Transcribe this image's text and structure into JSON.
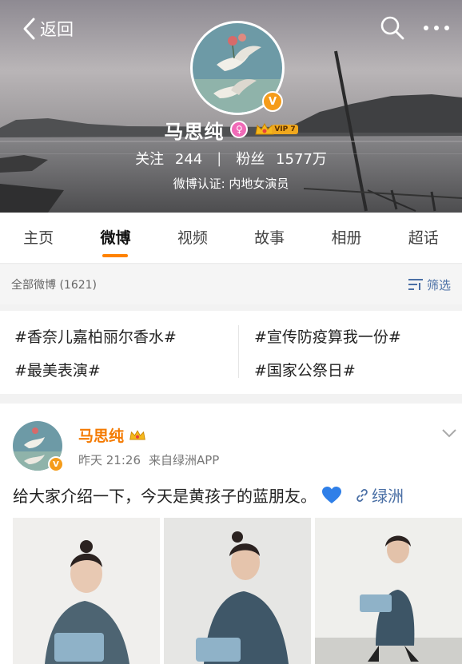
{
  "nav": {
    "back_label": "返回",
    "back_icon": "chevron-left-icon",
    "search_icon": "search-icon",
    "more_icon": "more-dots-icon"
  },
  "profile": {
    "name": "马思纯",
    "verified_badge": "V",
    "gender_badge": "♀",
    "vip_label": "VIP 7",
    "following_label": "关注",
    "following_count": "244",
    "separator": "|",
    "followers_label": "粉丝",
    "followers_count": "1577万",
    "verification": "微博认证: 内地女演员"
  },
  "tabs": [
    {
      "label": "主页"
    },
    {
      "label": "微博"
    },
    {
      "label": "视频"
    },
    {
      "label": "故事"
    },
    {
      "label": "相册"
    },
    {
      "label": "超话"
    }
  ],
  "filter": {
    "count_text": "全部微博 (1621)",
    "filter_label": "筛选"
  },
  "topics": [
    "#香奈儿嘉柏丽尔香水#",
    "#宣传防疫算我一份#",
    "#最美表演#",
    "#国家公祭日#"
  ],
  "post": {
    "author": "马思纯",
    "verified_badge": "V",
    "time": "昨天 21:26",
    "source": "来自绿洲APP",
    "text_before": "给大家介绍一下，今天是黄孩子的蓝朋友。",
    "heart_emoji": "blue-heart-icon",
    "link_label": "绿洲"
  },
  "colors": {
    "accent_orange": "#ff8200",
    "author_orange": "#f47a00",
    "link_blue": "#4a6fa5",
    "verified_orange": "#f59c1a"
  }
}
